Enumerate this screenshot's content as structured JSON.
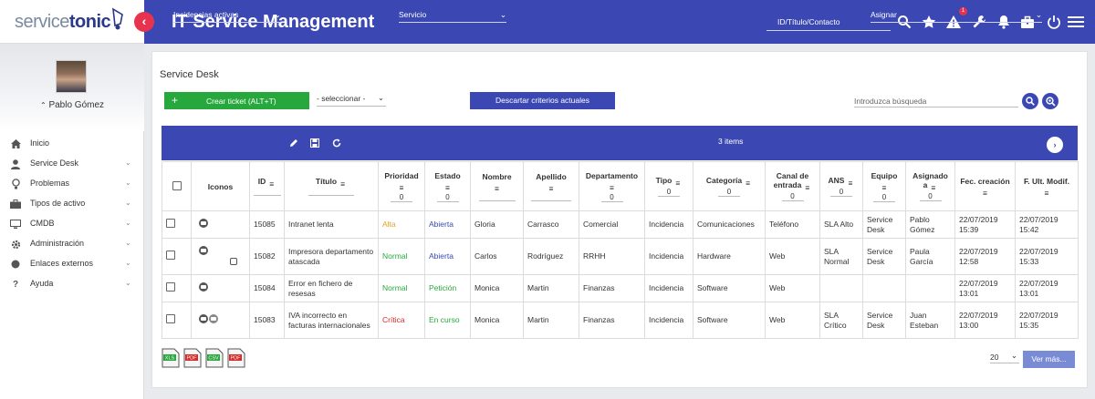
{
  "brand": {
    "logo_part1": "service",
    "logo_part2": "tonic"
  },
  "app_title": "IT Service Management",
  "top_search_placeholder": "ID/Título/Contacto",
  "alert_count": "1",
  "user": {
    "name": "Pablo Gómez"
  },
  "nav": [
    {
      "label": "Inicio",
      "icon": "home-icon"
    },
    {
      "label": "Service Desk",
      "icon": "user-icon"
    },
    {
      "label": "Problemas",
      "icon": "lightbulb-icon"
    },
    {
      "label": "Tipos de activo",
      "icon": "briefcase-icon"
    },
    {
      "label": "CMDB",
      "icon": "monitor-icon"
    },
    {
      "label": "Administración",
      "icon": "gear-icon"
    },
    {
      "label": "Enlaces externos",
      "icon": "circle-icon"
    },
    {
      "label": "Ayuda",
      "icon": "question-icon"
    }
  ],
  "page": {
    "title": "Service Desk",
    "create_label": "Crear ticket (ALT+T)",
    "select_label": "- seleccionar -",
    "discard_label": "Descartar criterios actuales",
    "search_placeholder": "Introduzca búsqueda"
  },
  "filters": {
    "view": "Incidencias activas",
    "service": "Servicio",
    "items": "3 items",
    "assign": "Asignar"
  },
  "columns": {
    "iconos": "Iconos",
    "id": "ID",
    "titulo": "Título",
    "prioridad": "Prioridad",
    "estado": "Estado",
    "nombre": "Nombre",
    "apellido": "Apellido",
    "departamento": "Departamento",
    "tipo": "Tipo",
    "categoria": "Categoría",
    "canal": "Canal de entrada",
    "ans": "ANS",
    "equipo": "Equipo",
    "asignado": "Asignado a",
    "fec_creacion": "Fec. creación",
    "fec_modif": "F. Ult. Modif."
  },
  "filter_zero": "0",
  "rows": [
    {
      "id": "15085",
      "titulo": "Intranet lenta",
      "prioridad": "Alta",
      "estado": "Abierta",
      "nombre": "Gloria",
      "apellido": "Carrasco",
      "departamento": "Comercial",
      "tipo": "Incidencia",
      "categoria": "Comunicaciones",
      "canal": "Teléfono",
      "ans": "SLA Alto",
      "equipo": "Service Desk",
      "asignado": "Pablo Gómez",
      "creacion": "22/07/2019 15:39",
      "modif": "22/07/2019 15:42",
      "icons": 1
    },
    {
      "id": "15082",
      "titulo": "Impresora departamento atascada",
      "prioridad": "Normal",
      "estado": "Abierta",
      "nombre": "Carlos",
      "apellido": "Rodríguez",
      "departamento": "RRHH",
      "tipo": "Incidencia",
      "categoria": "Hardware",
      "canal": "Web",
      "ans": "SLA Normal",
      "equipo": "Service Desk",
      "asignado": "Paula García",
      "creacion": "22/07/2019 12:58",
      "modif": "22/07/2019 15:33",
      "icons": 2
    },
    {
      "id": "15084",
      "titulo": "Error en fichero de resesas",
      "prioridad": "Normal",
      "estado": "Petición",
      "nombre": "Monica",
      "apellido": "Martin",
      "departamento": "Finanzas",
      "tipo": "Incidencia",
      "categoria": "Software",
      "canal": "Web",
      "ans": "",
      "equipo": "",
      "asignado": "",
      "creacion": "22/07/2019 13:01",
      "modif": "22/07/2019 13:01",
      "icons": 1
    },
    {
      "id": "15083",
      "titulo": "IVA incorrecto en facturas internacionales",
      "prioridad": "Crítica",
      "estado": "En curso",
      "nombre": "Monica",
      "apellido": "Martin",
      "departamento": "Finanzas",
      "tipo": "Incidencia",
      "categoria": "Software",
      "canal": "Web",
      "ans": "SLA Crítico",
      "equipo": "Service Desk",
      "asignado": "Juan Esteban",
      "creacion": "22/07/2019 13:00",
      "modif": "22/07/2019 15:35",
      "icons": 2
    }
  ],
  "exports": [
    {
      "label": "XLS",
      "color": "#27a83d"
    },
    {
      "label": "PDF",
      "color": "#d62a2a"
    },
    {
      "label": "CSV",
      "color": "#27a83d"
    },
    {
      "label": "PDF",
      "color": "#d62a2a"
    }
  ],
  "footer": {
    "page_size": "20",
    "more_label": "Ver más..."
  }
}
